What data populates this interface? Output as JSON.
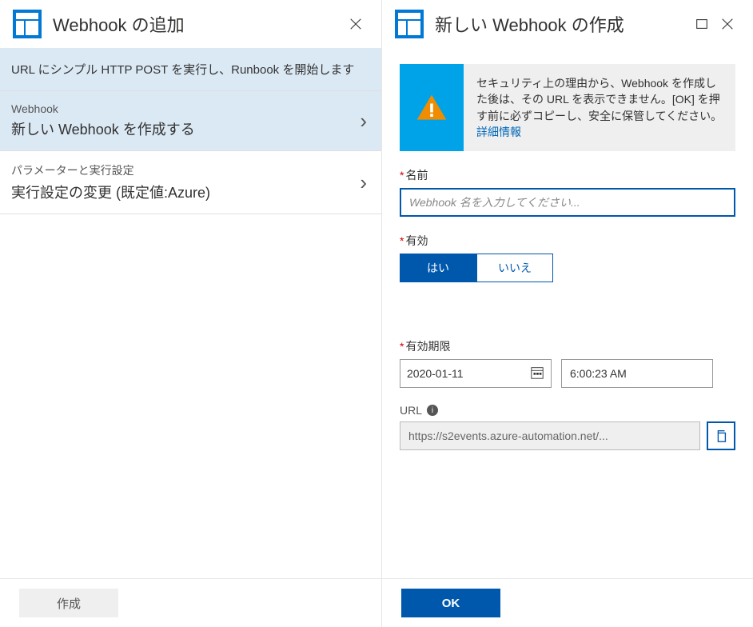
{
  "left_panel": {
    "title": "Webhook の追加",
    "description": "URL にシンプル HTTP POST を実行し、Runbook を開始します",
    "items": [
      {
        "label": "Webhook",
        "value": "新しい Webhook を作成する",
        "selected": true
      },
      {
        "label": "パラメーターと実行設定",
        "value": "実行設定の変更 (既定値:Azure)",
        "selected": false
      }
    ],
    "create_button": "作成"
  },
  "right_panel": {
    "title": "新しい Webhook の作成",
    "warning_text": "セキュリティ上の理由から、Webhook を作成した後は、その URL を表示できません。[OK] を押す前に必ずコピーし、安全に保管してください。",
    "warning_link": "詳細情報",
    "name_label": "名前",
    "name_placeholder": "Webhook 名を入力してください...",
    "enabled_label": "有効",
    "enabled_yes": "はい",
    "enabled_no": "いいえ",
    "expiry_label": "有効期限",
    "expiry_date": "2020-01-11",
    "expiry_time": "6:00:23 AM",
    "url_label": "URL",
    "url_value": "https://s2events.azure-automation.net/...",
    "ok_button": "OK"
  }
}
